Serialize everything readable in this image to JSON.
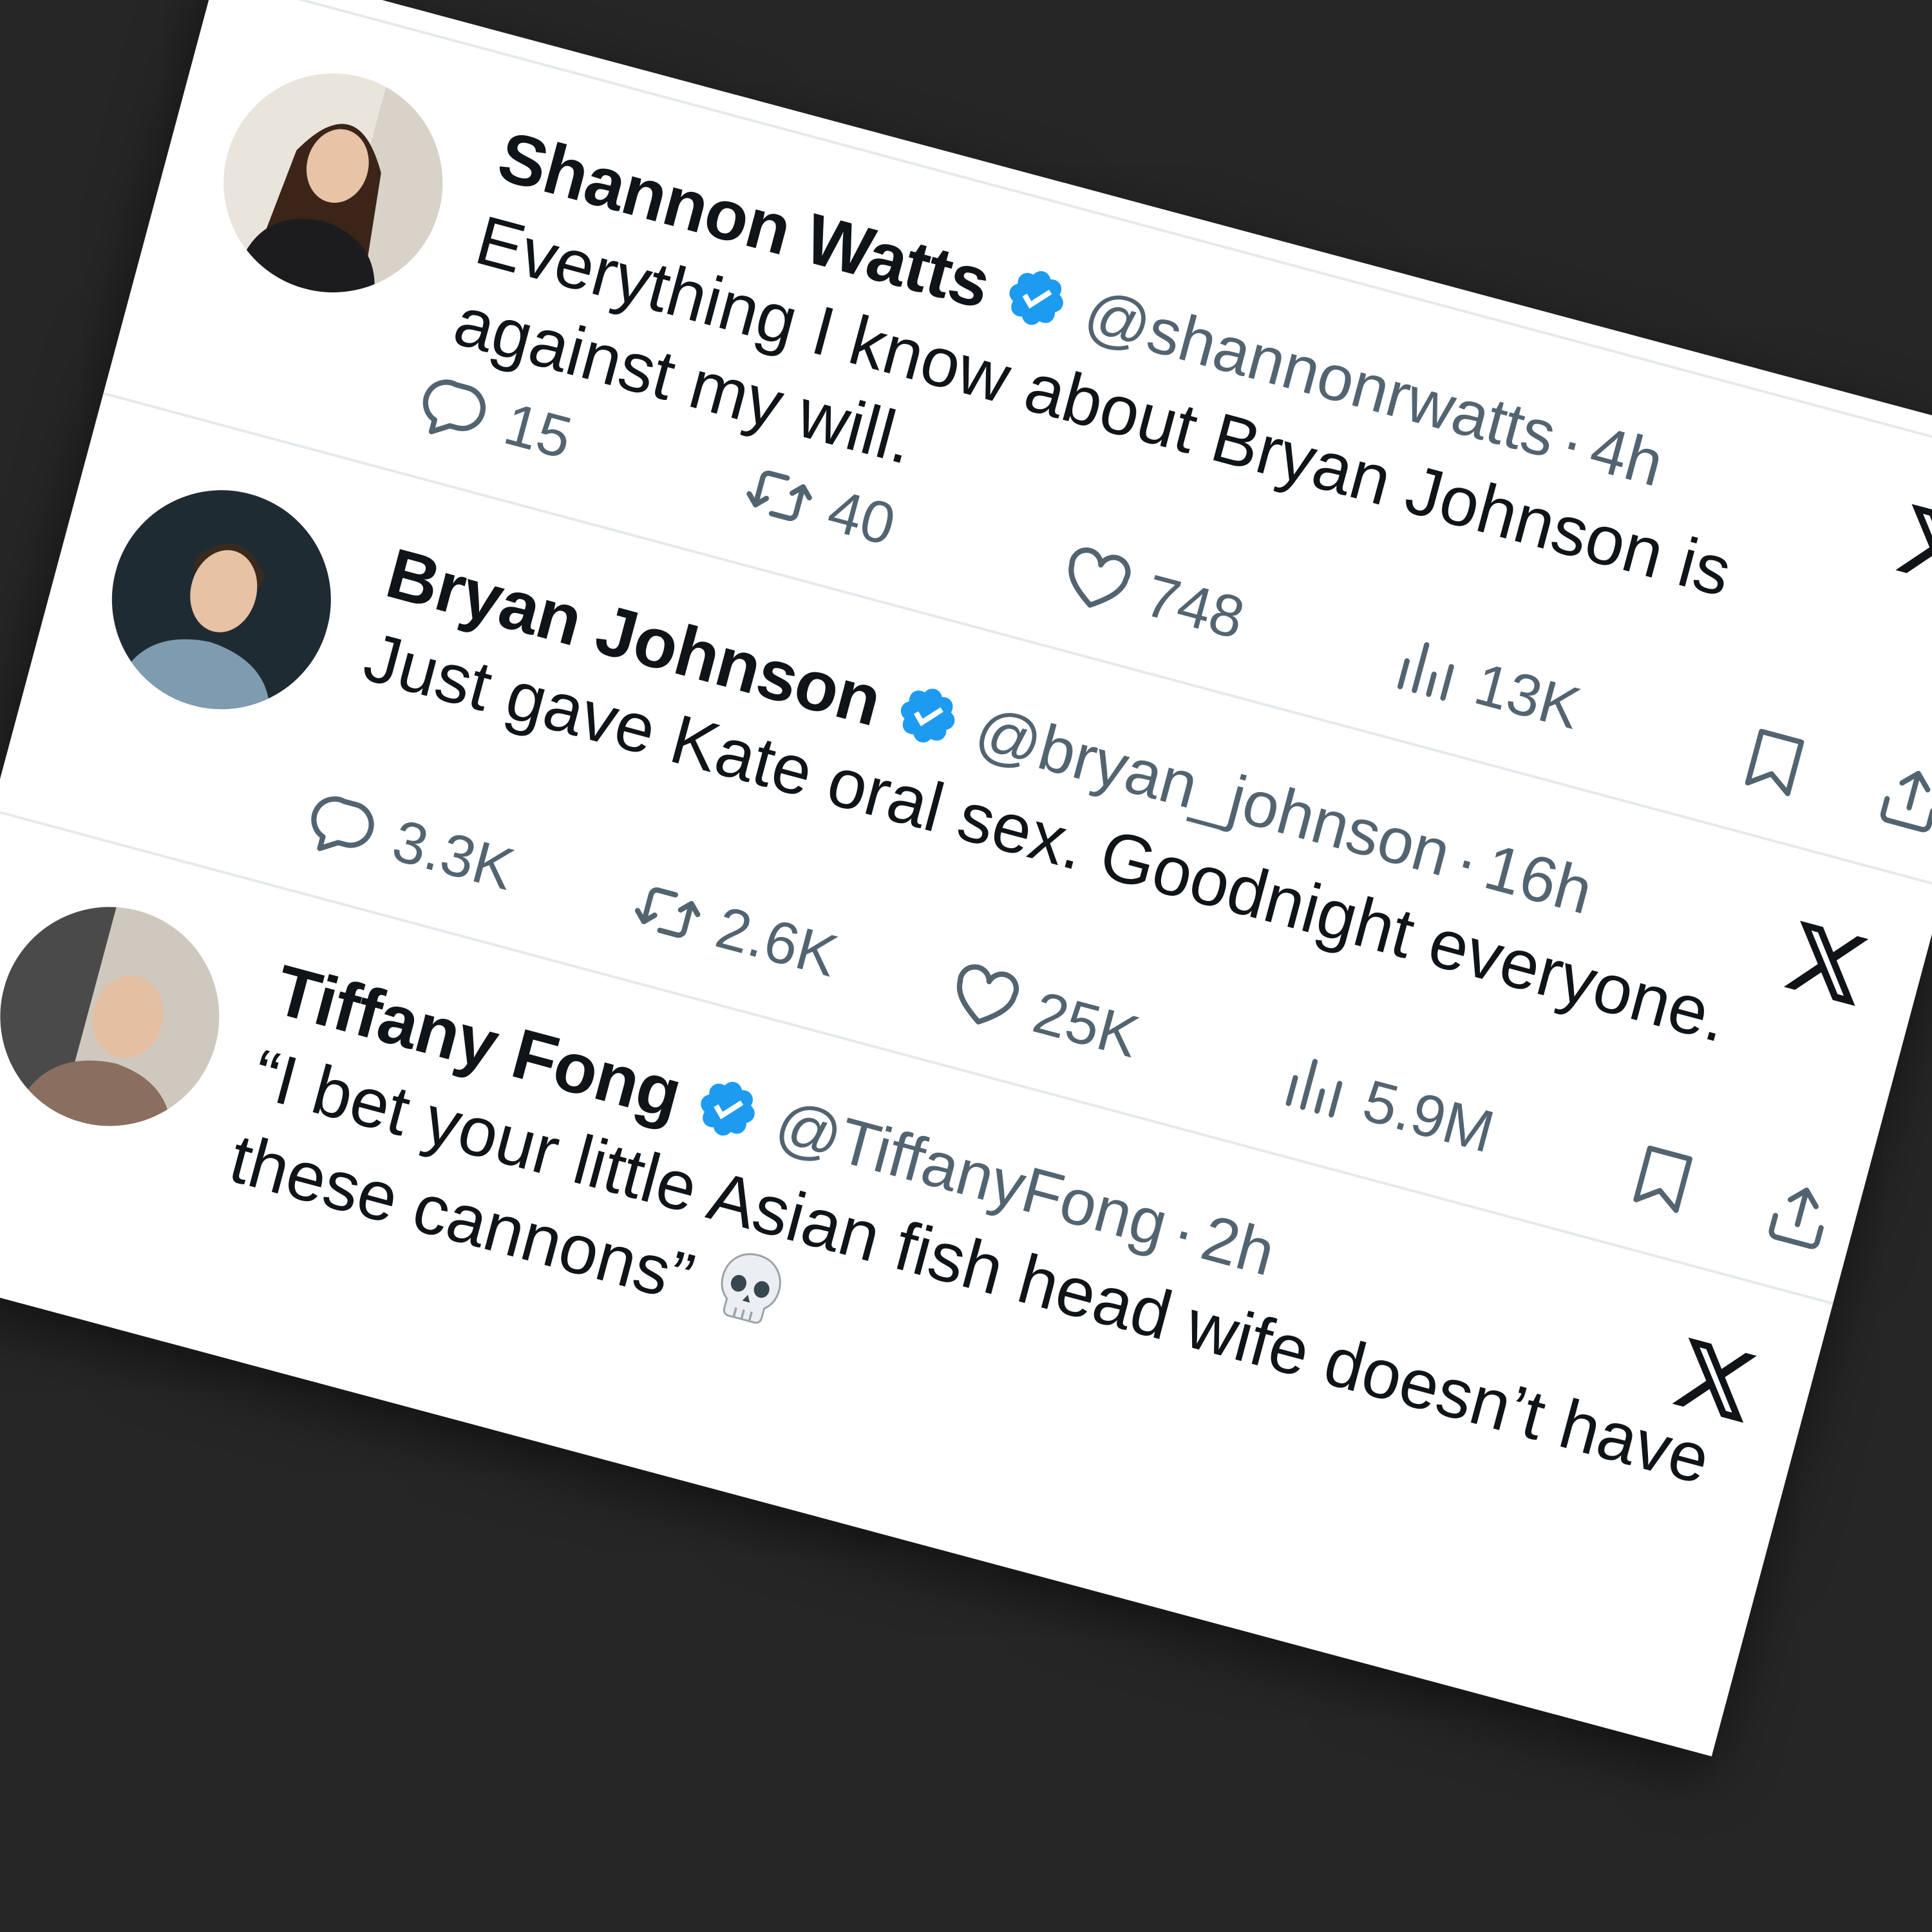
{
  "icons": {
    "reply": "reply-icon",
    "repost": "repost-icon",
    "like": "heart-icon",
    "views": "views-icon",
    "bookmark": "bookmark-icon",
    "share": "share-icon",
    "brand": "x-logo-icon",
    "verified": "verified-badge-icon"
  },
  "colors": {
    "verified": "#1d9bf0",
    "secondary_text": "#536471",
    "primary_text": "#0f1419",
    "background": "#262626"
  },
  "tweets": [
    {
      "name": "Shannon Watts",
      "handle": "@shannonrwatts",
      "separator": "·",
      "time": "4h",
      "text": "Everything I know about Bryan Johnson is against my will.",
      "replies": "15",
      "reposts": "40",
      "likes": "748",
      "views": "13K"
    },
    {
      "name": "Bryan Johnson",
      "handle": "@bryan_johnson",
      "separator": "·",
      "time": "16h",
      "text": "Just gave Kate oral sex. Goodnight everyone.",
      "replies": "3.3K",
      "reposts": "2.6K",
      "likes": "25K",
      "views": "5.9M"
    },
    {
      "name": "Tiffany Fong",
      "handle": "@TiffanyFong",
      "separator": "·",
      "time": "2h",
      "text": "“I bet your little Asian fish head wife doesn’t have these cannons”",
      "emoji": "skull-emoji-icon"
    }
  ]
}
